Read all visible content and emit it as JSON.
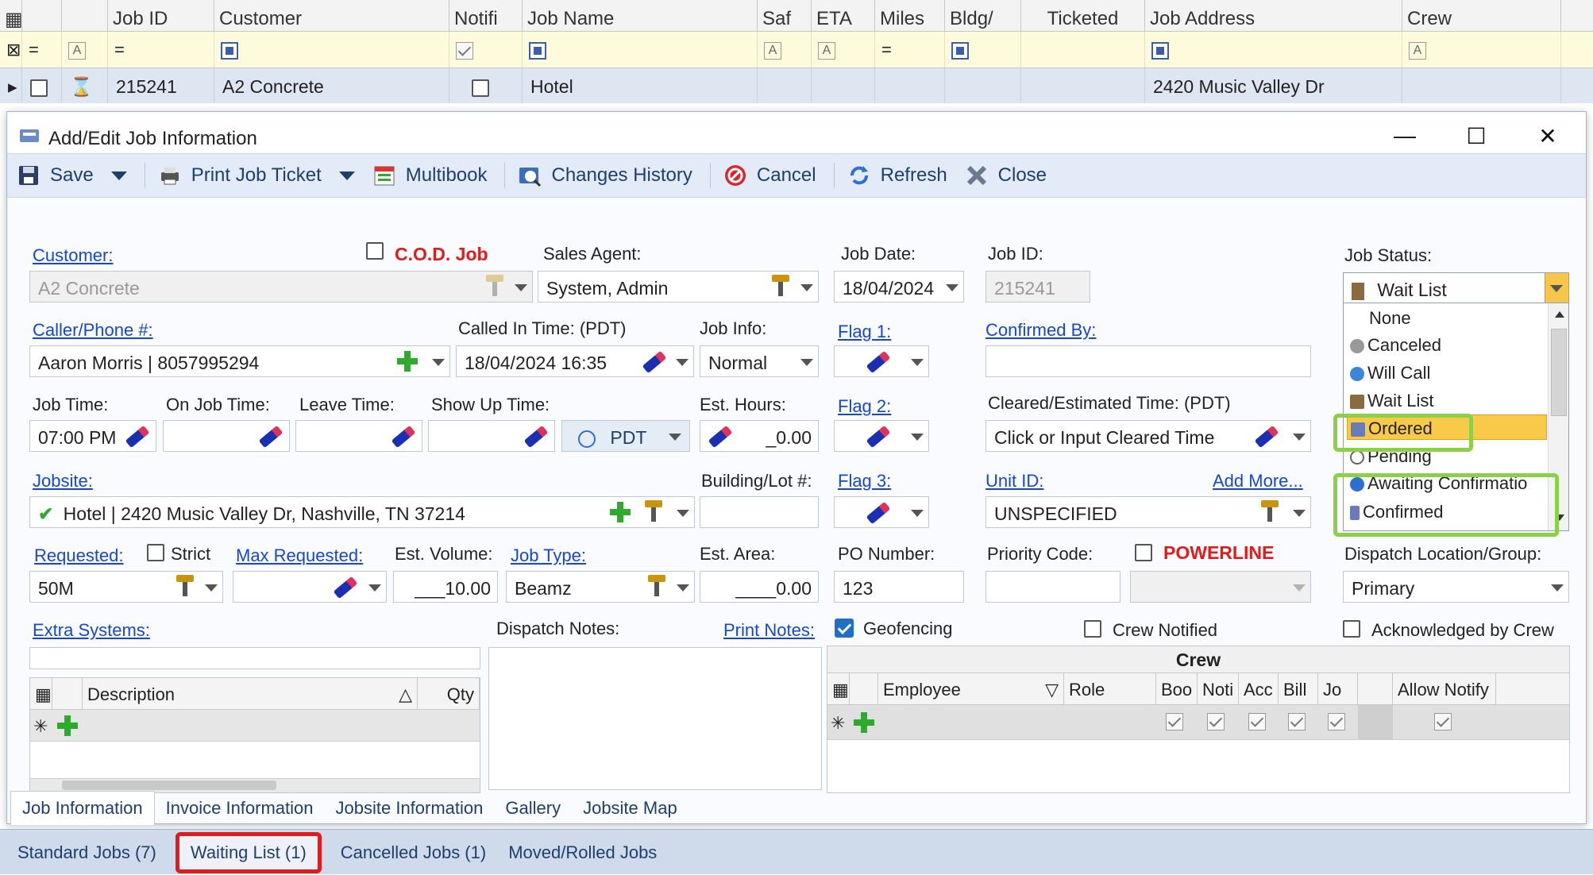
{
  "grid": {
    "headers": [
      "Job ID",
      "Customer",
      "Notifi",
      "Job Name",
      "Saf",
      "ETA",
      "Miles",
      "Bldg/",
      "Ticketed",
      "Job Address",
      "Crew"
    ],
    "row": {
      "job_id": "215241",
      "customer": "A2 Concrete",
      "job_name": "Hotel",
      "job_address": "2420 Music Valley Dr"
    },
    "filter_eq": "="
  },
  "dialog": {
    "title": "Add/Edit Job Information",
    "window_controls": {
      "minimize": "—",
      "maximize": "☐",
      "close": "✕"
    },
    "toolbar": {
      "save": "Save",
      "print_ticket": "Print Job Ticket",
      "multibook": "Multibook",
      "changes_history": "Changes History",
      "cancel": "Cancel",
      "refresh": "Refresh",
      "close": "Close"
    },
    "customer": {
      "label": "Customer:",
      "value": "A2 Concrete"
    },
    "cod": "C.O.D. Job",
    "sales_agent": {
      "label": "Sales Agent:",
      "value": "System, Admin"
    },
    "job_date": {
      "label": "Job Date:",
      "value": "18/04/2024"
    },
    "job_id": {
      "label": "Job ID:",
      "value": "215241"
    },
    "job_status": {
      "label": "Job Status:",
      "value": "Wait List"
    },
    "caller": {
      "label": "Caller/Phone #:",
      "value": "Aaron Morris | 8057995294"
    },
    "called_in": {
      "label": "Called In Time: (PDT)",
      "value": "18/04/2024 16:35"
    },
    "job_info": {
      "label": "Job Info:",
      "value": "Normal"
    },
    "flag1": "Flag 1:",
    "flag2": "Flag 2:",
    "flag3": "Flag 3:",
    "confirmed_by": "Confirmed By:",
    "job_time": {
      "label": "Job Time:",
      "value": "07:00 PM"
    },
    "on_job_time": "On Job Time:",
    "leave_time": "Leave Time:",
    "show_up_time": "Show Up Time:",
    "timezone": "PDT",
    "est_hours": {
      "label": "Est. Hours:",
      "value": "_0.00"
    },
    "cleared": {
      "label": "Cleared/Estimated Time: (PDT)",
      "value": "Click or Input Cleared Time"
    },
    "jobsite": {
      "label": "Jobsite:",
      "value": "Hotel | 2420 Music Valley Dr, Nashville, TN 37214"
    },
    "building_lot": "Building/Lot #:",
    "unit_id": {
      "label": "Unit ID:",
      "add_more": "Add More...",
      "value": "UNSPECIFIED"
    },
    "requested": {
      "label": "Requested:",
      "value": "50M"
    },
    "strict": "Strict",
    "max_requested": "Max Requested:",
    "est_volume": {
      "label": "Est. Volume:",
      "value": "___10.00"
    },
    "job_type": {
      "label": "Job Type:",
      "value": "Beamz"
    },
    "est_area": {
      "label": "Est. Area:",
      "value": "____0.00"
    },
    "po_number": {
      "label": "PO Number:",
      "value": "123"
    },
    "priority_code": "Priority Code:",
    "powerline": "POWERLINE",
    "dispatch_location": {
      "label": "Dispatch Location/Group:",
      "value": "Primary"
    },
    "extra_systems": "Extra Systems:",
    "dispatch_notes": "Dispatch Notes:",
    "print_notes": "Print Notes:",
    "geofencing": "Geofencing",
    "crew_notified": "Crew Notified",
    "ack_crew": "Acknowledged by Crew",
    "extra_table": {
      "cols": [
        "Description",
        "Qty"
      ]
    },
    "crew_table": {
      "title": "Crew",
      "cols": [
        "Employee",
        "Role",
        "Boo",
        "Noti",
        "Acc",
        "Bill",
        "Jo",
        "",
        "Allow Notify"
      ]
    },
    "tabs": [
      "Job Information",
      "Invoice Information",
      "Jobsite Information",
      "Gallery",
      "Jobsite Map"
    ]
  },
  "status_list": [
    "None",
    "Canceled",
    "Will Call",
    "Wait List",
    "Ordered",
    "Pending",
    "Awaiting Confirmatio",
    "Confirmed"
  ],
  "bottom_tabs": [
    "Standard Jobs (7)",
    "Waiting List (1)",
    "Cancelled Jobs (1)",
    "Moved/Rolled Jobs"
  ],
  "colors": {
    "link": "#1646d6",
    "highlight_green": "#8bd045",
    "highlight_red": "#e01b1b",
    "selected": "#f9c94a",
    "toolbar_bg": "#e2ebf7"
  }
}
